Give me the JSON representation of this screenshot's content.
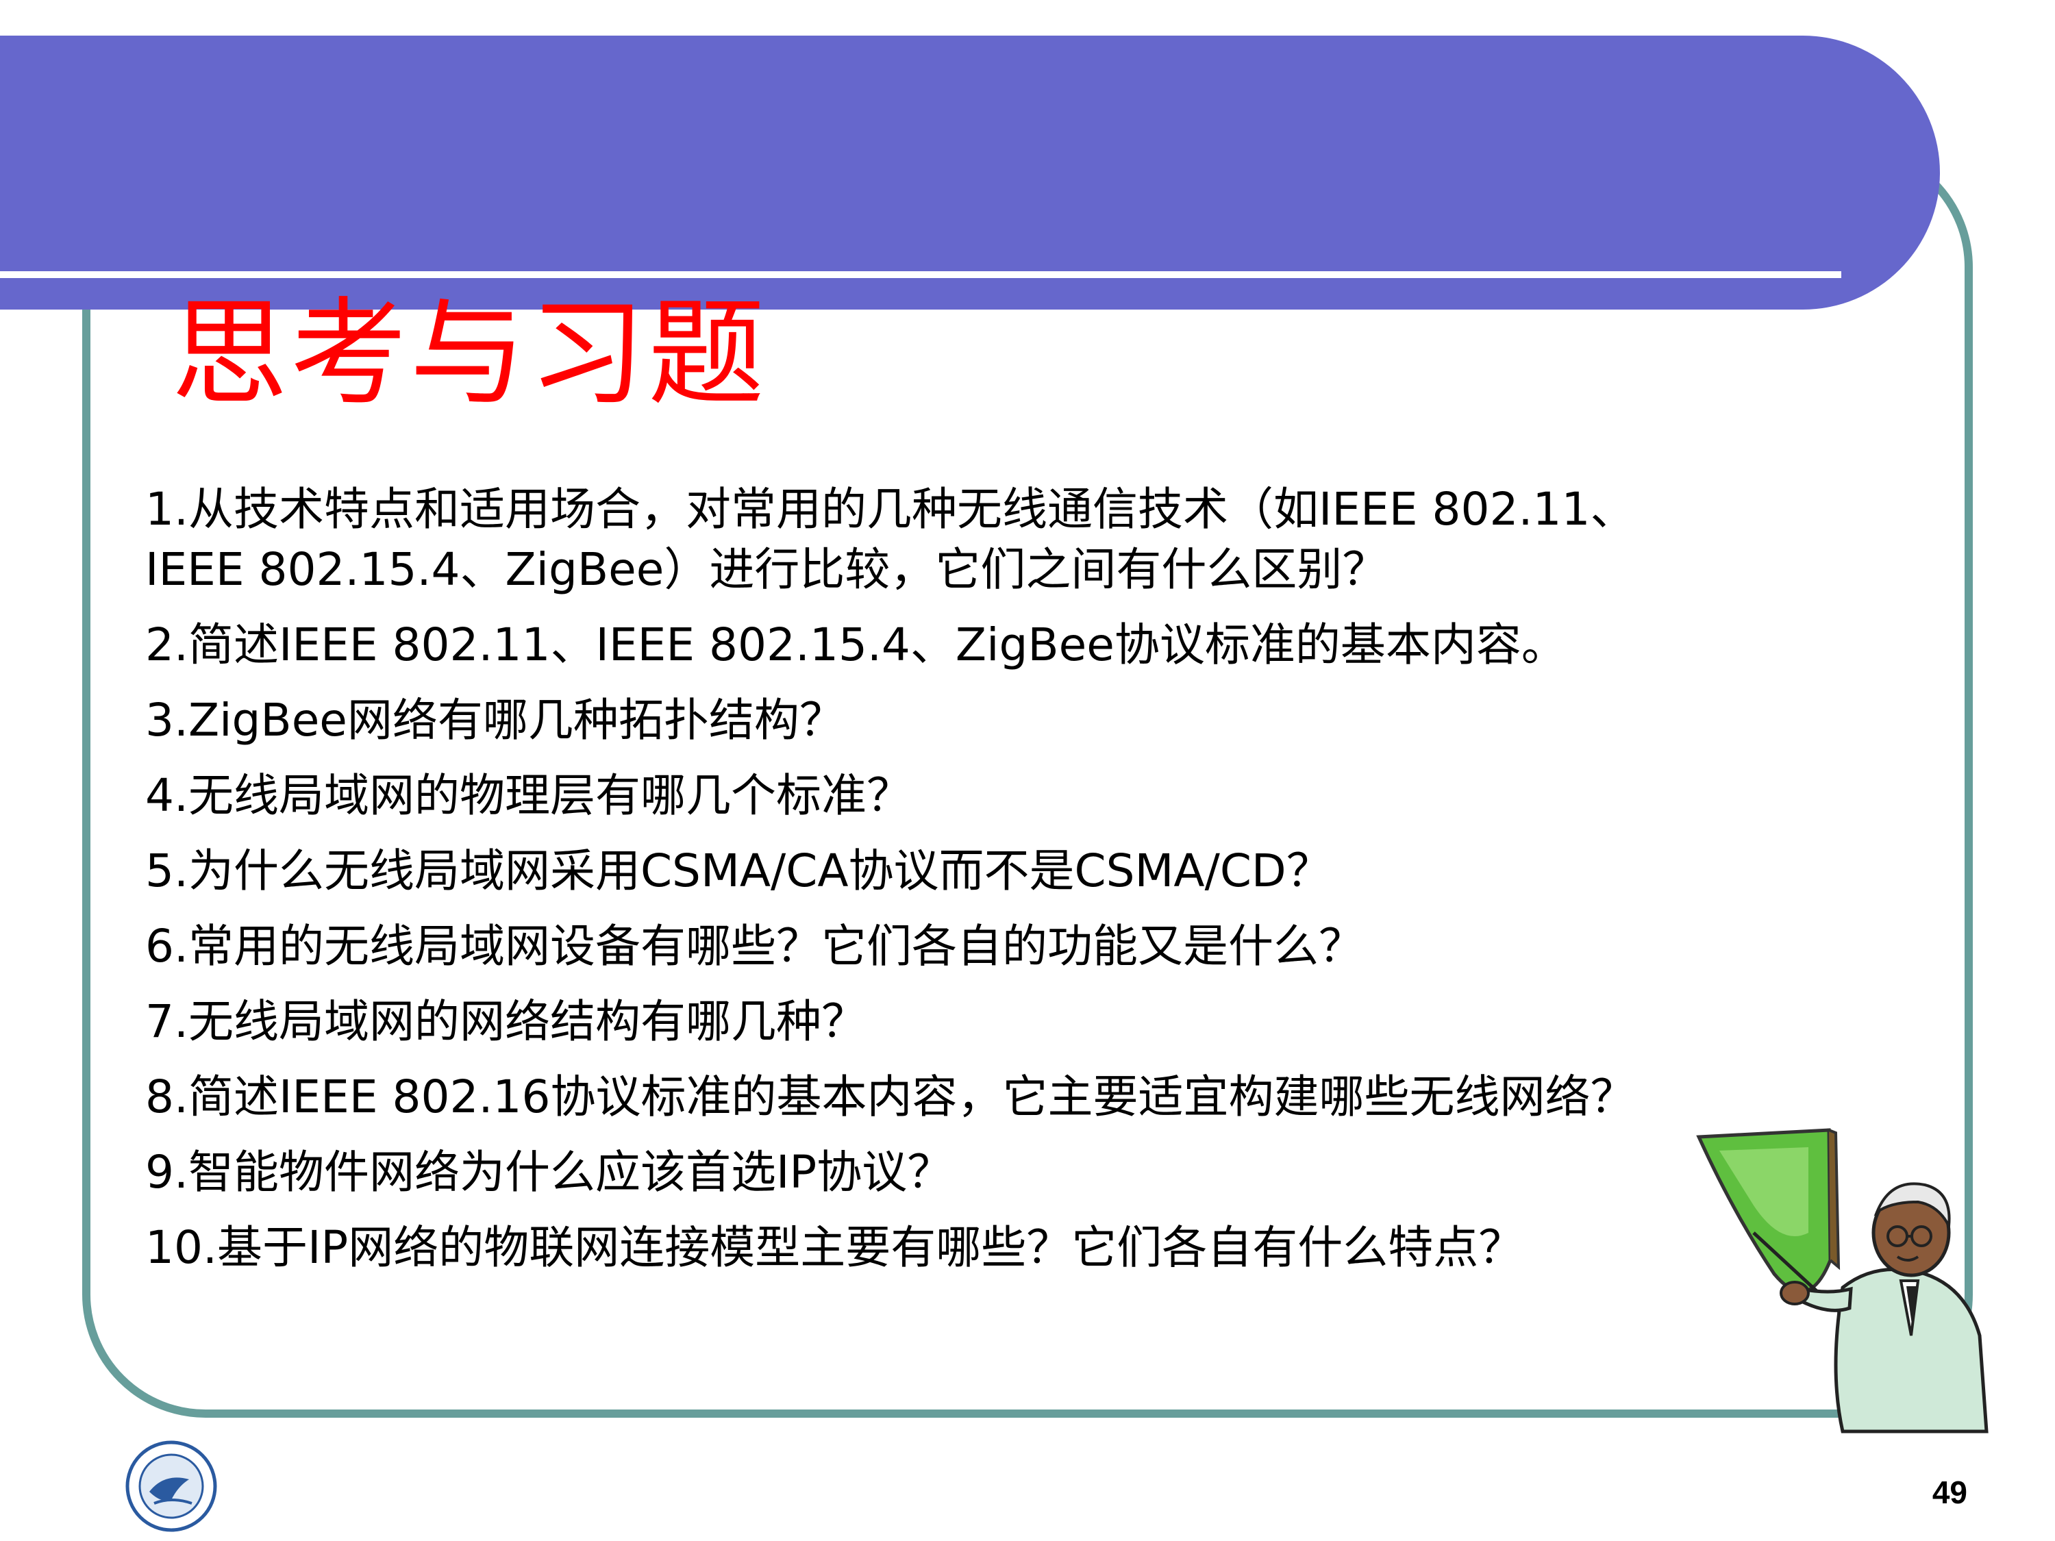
{
  "slide": {
    "title": "思考与习题",
    "page_number": "49",
    "colors": {
      "banner": "#6667cc",
      "frame": "#679e9b",
      "title": "#ff0000",
      "text": "#000000"
    },
    "questions": [
      "1.从技术特点和适用场合，对常用的几种无线通信技术（如IEEE 802.11、\nIEEE 802.15.4、ZigBee）进行比较，它们之间有什么区别？",
      "2.简述IEEE 802.11、IEEE 802.15.4、ZigBee协议标准的基本内容。",
      "3.ZigBee网络有哪几种拓扑结构？",
      "4.无线局域网的物理层有哪几个标准？",
      "5.为什么无线局域网采用CSMA/CA协议而不是CSMA/CD？",
      "6.常用的无线局域网设备有哪些？它们各自的功能又是什么？",
      "7.无线局域网的网络结构有哪几种？",
      "8.简述IEEE 802.16协议标准的基本内容，它主要适宜构建哪些无线网络？",
      "9.智能物件网络为什么应该首选IP协议？",
      "10.基于IP网络的物联网连接模型主要有哪些？它们各自有什么特点？"
    ],
    "decorations": {
      "teacher_clipart": "teacher-pointing-at-board-icon",
      "university_logo": "university-emblem-icon"
    }
  }
}
